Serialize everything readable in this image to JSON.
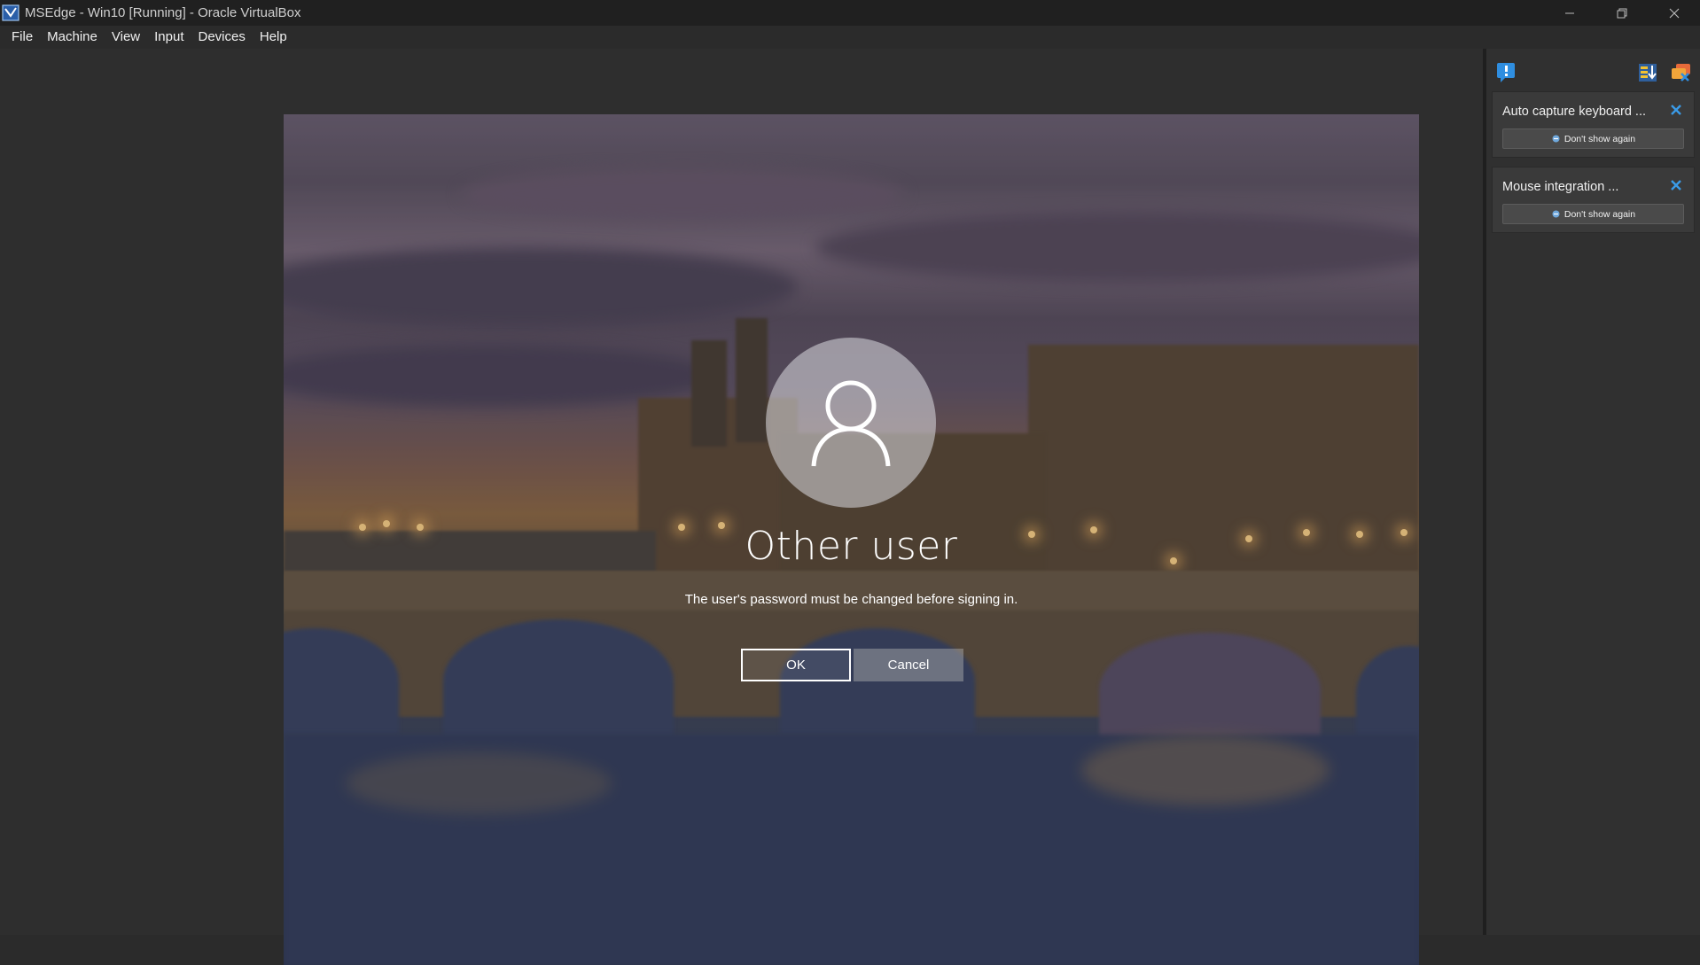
{
  "window": {
    "title": "MSEdge - Win10 [Running] - Oracle VirtualBox",
    "controls": [
      "minimize",
      "restore",
      "close"
    ]
  },
  "menubar": {
    "items": [
      "File",
      "Machine",
      "View",
      "Input",
      "Devices",
      "Help"
    ]
  },
  "vm_screen": {
    "user_name": "Other user",
    "message": "The user's password must be changed before signing in.",
    "ok_label": "OK",
    "cancel_label": "Cancel"
  },
  "notifications": {
    "toolbar_icons": [
      "notification-center-icon",
      "sort-icon",
      "clear-all-icon"
    ],
    "items": [
      {
        "title": "Auto capture keyboard ...",
        "button_label": "Don't show again"
      },
      {
        "title": "Mouse integration ...",
        "button_label": "Don't show again"
      }
    ]
  },
  "colors": {
    "titlebar": "#202020",
    "background": "#2b2b2b",
    "panel": "#303030",
    "accent_blue": "#2f8ee0",
    "accent_yellow": "#f2c230"
  }
}
